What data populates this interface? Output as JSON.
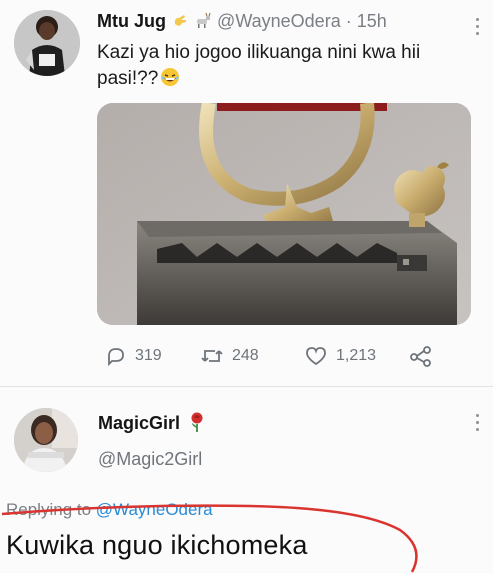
{
  "tweet": {
    "display_name": "Mtu Jug",
    "handle": "@WayneOdera",
    "separator": "·",
    "time": "15h",
    "text": "Kazi ya hio jogoo ilikuanga nini kwa hii pasi!??",
    "stats": {
      "replies": "319",
      "retweets": "248",
      "likes": "1,213"
    }
  },
  "reply": {
    "display_name": "MagicGirl",
    "handle": "@Magic2Girl",
    "replying_label": "Replying to",
    "replying_to": "@WayneOdera",
    "text": "Kuwika nguo ikichomeka"
  },
  "colors": {
    "link": "#2a8bd6",
    "muted": "#7a7f85",
    "annotation": "#d9342f"
  },
  "icons": [
    "reply-icon",
    "retweet-icon",
    "like-icon",
    "share-icon",
    "rose-icon",
    "hand-emoji-icon",
    "goat-emoji-icon",
    "laughing-emoji-icon"
  ]
}
